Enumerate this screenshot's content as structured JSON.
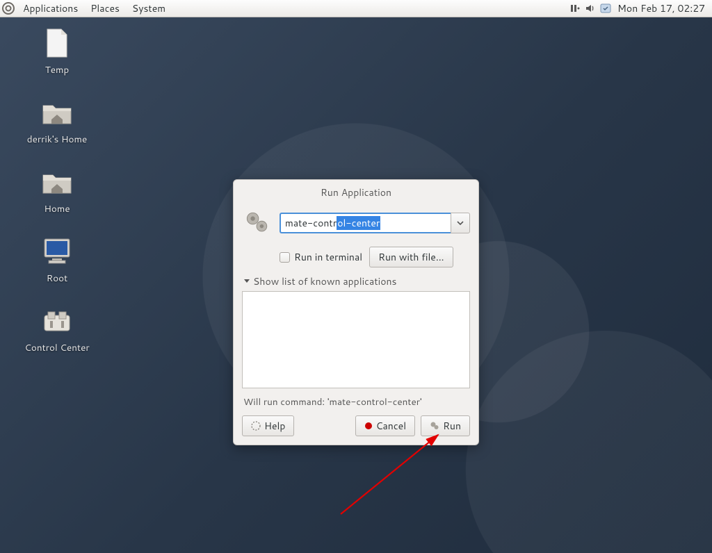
{
  "panel": {
    "menus": [
      "Applications",
      "Places",
      "System"
    ],
    "clock": "Mon Feb 17, 02:27"
  },
  "desktop_icons": [
    {
      "label": "Temp",
      "kind": "file"
    },
    {
      "label": "derrik's Home",
      "kind": "folder-home"
    },
    {
      "label": "Home",
      "kind": "folder-home"
    },
    {
      "label": "Root",
      "kind": "computer"
    },
    {
      "label": "Control Center",
      "kind": "control"
    }
  ],
  "dialog": {
    "title": "Run Application",
    "command_typed": "mate-contr",
    "command_completion": "ol-center",
    "run_in_terminal": "Run in terminal",
    "run_with_file": "Run with file...",
    "expander": "Show list of known applications",
    "status": "Will run command: 'mate-control-center'",
    "help": "Help",
    "cancel": "Cancel",
    "run": "Run"
  }
}
